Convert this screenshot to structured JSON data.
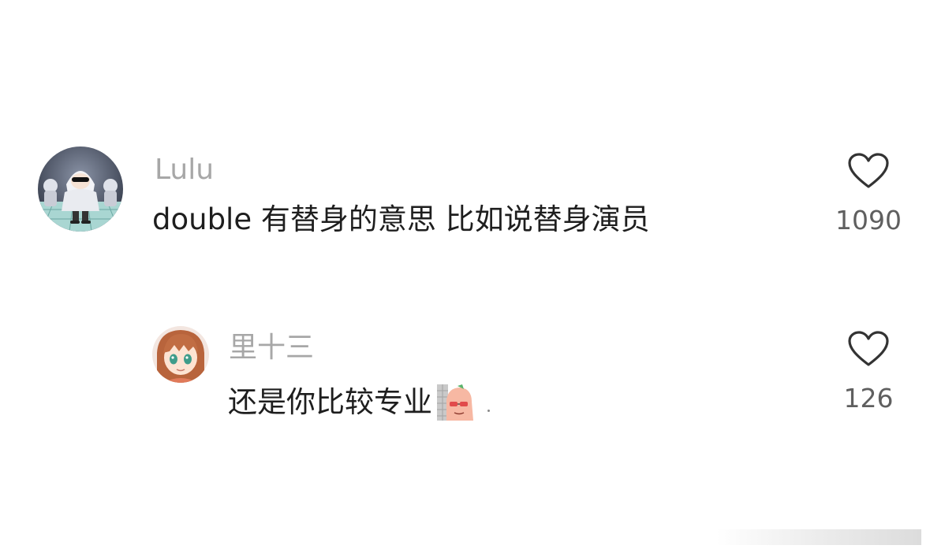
{
  "comments": [
    {
      "username": "Lulu",
      "text": "double 有替身的意思 比如说替身演员",
      "likes": "1090",
      "avatar_icon": "hooded-character-avatar"
    },
    {
      "username": "里十三",
      "text": "还是你比较专业",
      "likes": "126",
      "avatar_icon": "anime-girl-avatar",
      "sticker_icon": "peeking-peanut-sticker"
    }
  ],
  "colors": {
    "username": "#a7a7a7",
    "text": "#1e1e1e",
    "count": "#5f5f5f",
    "heart_outline": "#333333"
  }
}
